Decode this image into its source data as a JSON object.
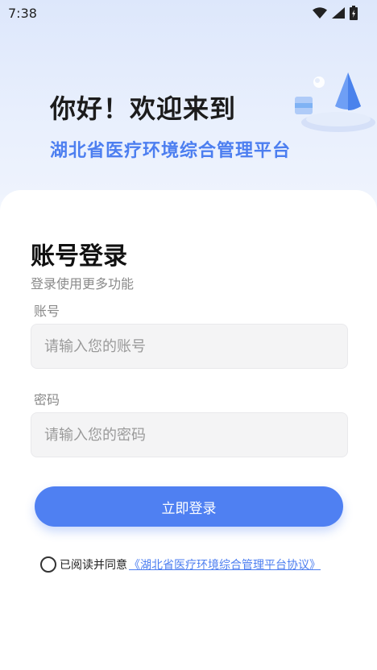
{
  "status_bar": {
    "time": "7:38",
    "icons": [
      "wifi-icon",
      "cellular-signal-icon",
      "battery-icon"
    ]
  },
  "hero": {
    "greeting": "你好！欢迎来到",
    "platform_name": "湖北省医疗环境综合管理平台"
  },
  "login": {
    "title": "账号登录",
    "subtitle": "登录使用更多功能",
    "account_label": "账号",
    "account_placeholder": "请输入您的账号",
    "account_value": "",
    "password_label": "密码",
    "password_placeholder": "请输入您的密码",
    "password_value": "",
    "submit_label": "立即登录"
  },
  "agreement": {
    "checked": false,
    "prefix": "已阅读并同意",
    "link_text": "《湖北省医疗环境综合管理平台协议》"
  },
  "colors": {
    "accent": "#4f80f2",
    "accent_text": "#4c7ef0",
    "header_bg": "#dde7fb",
    "input_bg": "#f4f4f5"
  }
}
